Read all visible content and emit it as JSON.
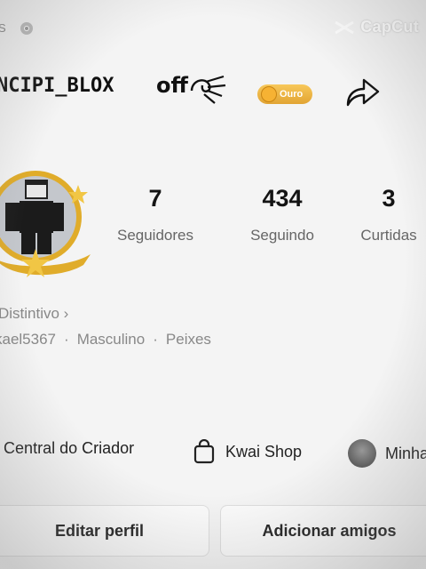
{
  "topbar": {
    "left_char": "S",
    "watermark": "CapCut"
  },
  "profile": {
    "username": "NCIPI_BLOX",
    "username_suffix": "off",
    "badge_label": "Ouro",
    "distintivo": "Distintivo ›",
    "info": [
      "kael5367",
      "Masculino",
      "Peixes"
    ]
  },
  "stats": [
    {
      "value": "7",
      "label": "Seguidores"
    },
    {
      "value": "434",
      "label": "Seguindo"
    },
    {
      "value": "3",
      "label": "Curtidas"
    }
  ],
  "shortcuts": [
    "Central do Criador",
    "Kwai Shop",
    "Minha"
  ],
  "buttons": {
    "edit": "Editar perfil",
    "add": "Adicionar amigos"
  },
  "colors": {
    "badge": "#f0b43f",
    "text": "#1a1a1a",
    "muted": "#888888"
  },
  "icons": [
    "chrome-icon",
    "capcut-logo-icon",
    "swirl-icon",
    "coin-icon",
    "share-icon",
    "avatar-image",
    "shopping-bag-icon",
    "dot-icon"
  ]
}
